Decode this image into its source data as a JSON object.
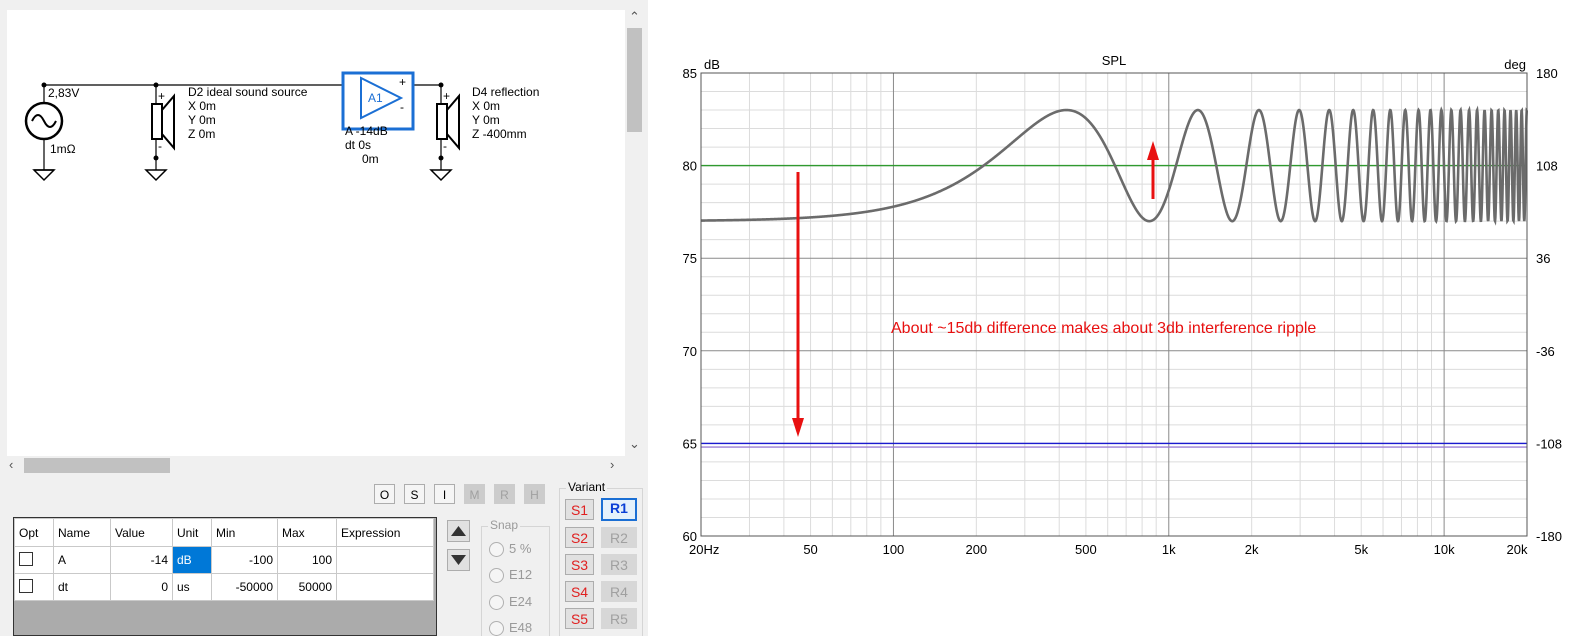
{
  "schematic": {
    "source": {
      "voltage": "2,83V",
      "impedance": "1mΩ"
    },
    "driver1": {
      "name": "D2 ideal sound source",
      "x": "X 0m",
      "y": "Y 0m",
      "z": "Z 0m"
    },
    "amp": {
      "id": "A1",
      "gain": "A  -14dB",
      "dt": "dt 0s",
      "dist": "0m"
    },
    "driver2": {
      "name": "D4 reflection",
      "x": "X 0m",
      "y": "Y 0m",
      "z": "Z -400mm"
    }
  },
  "filter_buttons": [
    "O",
    "S",
    "I",
    "M",
    "R",
    "H"
  ],
  "param_table": {
    "headers": [
      "Opt",
      "Name",
      "Value",
      "Unit",
      "Min",
      "Max",
      "Expression"
    ],
    "rows": [
      {
        "name": "A",
        "value": "-14",
        "unit": "dB",
        "min": "-100",
        "max": "100",
        "expression": ""
      },
      {
        "name": "dt",
        "value": "0",
        "unit": "us",
        "min": "-50000",
        "max": "50000",
        "expression": ""
      }
    ]
  },
  "snap": {
    "title": "Snap",
    "options": [
      "5 %",
      "E12",
      "E24",
      "E48"
    ]
  },
  "variant": {
    "title": "Variant",
    "s_buttons": [
      "S1",
      "S2",
      "S3",
      "S4",
      "S5"
    ],
    "r_buttons": [
      "R1",
      "R2",
      "R3",
      "R4",
      "R5"
    ]
  },
  "chart_data": {
    "type": "line",
    "title": "SPL",
    "ylabel_left": "dB",
    "ylabel_right": "deg",
    "x_scale": "log",
    "xlim": [
      20,
      20000
    ],
    "ylim_left": [
      60,
      85
    ],
    "ylim_right": [
      -180,
      180
    ],
    "x_ticks": [
      "20Hz",
      "50",
      "100",
      "200",
      "500",
      "1k",
      "2k",
      "5k",
      "10k",
      "20k"
    ],
    "y_ticks_left": [
      "85",
      "80",
      "75",
      "70",
      "65",
      "60"
    ],
    "y_ticks_right": [
      "180",
      "108",
      "36",
      "-36",
      "-108",
      "-180"
    ],
    "grid": true,
    "series": [
      {
        "color": "#6b6b6b",
        "mean_db": 80.0,
        "ripple_db": 3.0,
        "delay_ms": 1.1765,
        "note": ""
      },
      {
        "color": "#2f9a2f",
        "constant_db": 80.0
      },
      {
        "color": "#1a1ad0",
        "constant_db": 65.0
      },
      {
        "color": "#9b7fd4",
        "constant_db": 64.8
      }
    ],
    "annotation": "About ~15db difference makes about 3db interference ripple",
    "annotation_color": "#e81010"
  }
}
